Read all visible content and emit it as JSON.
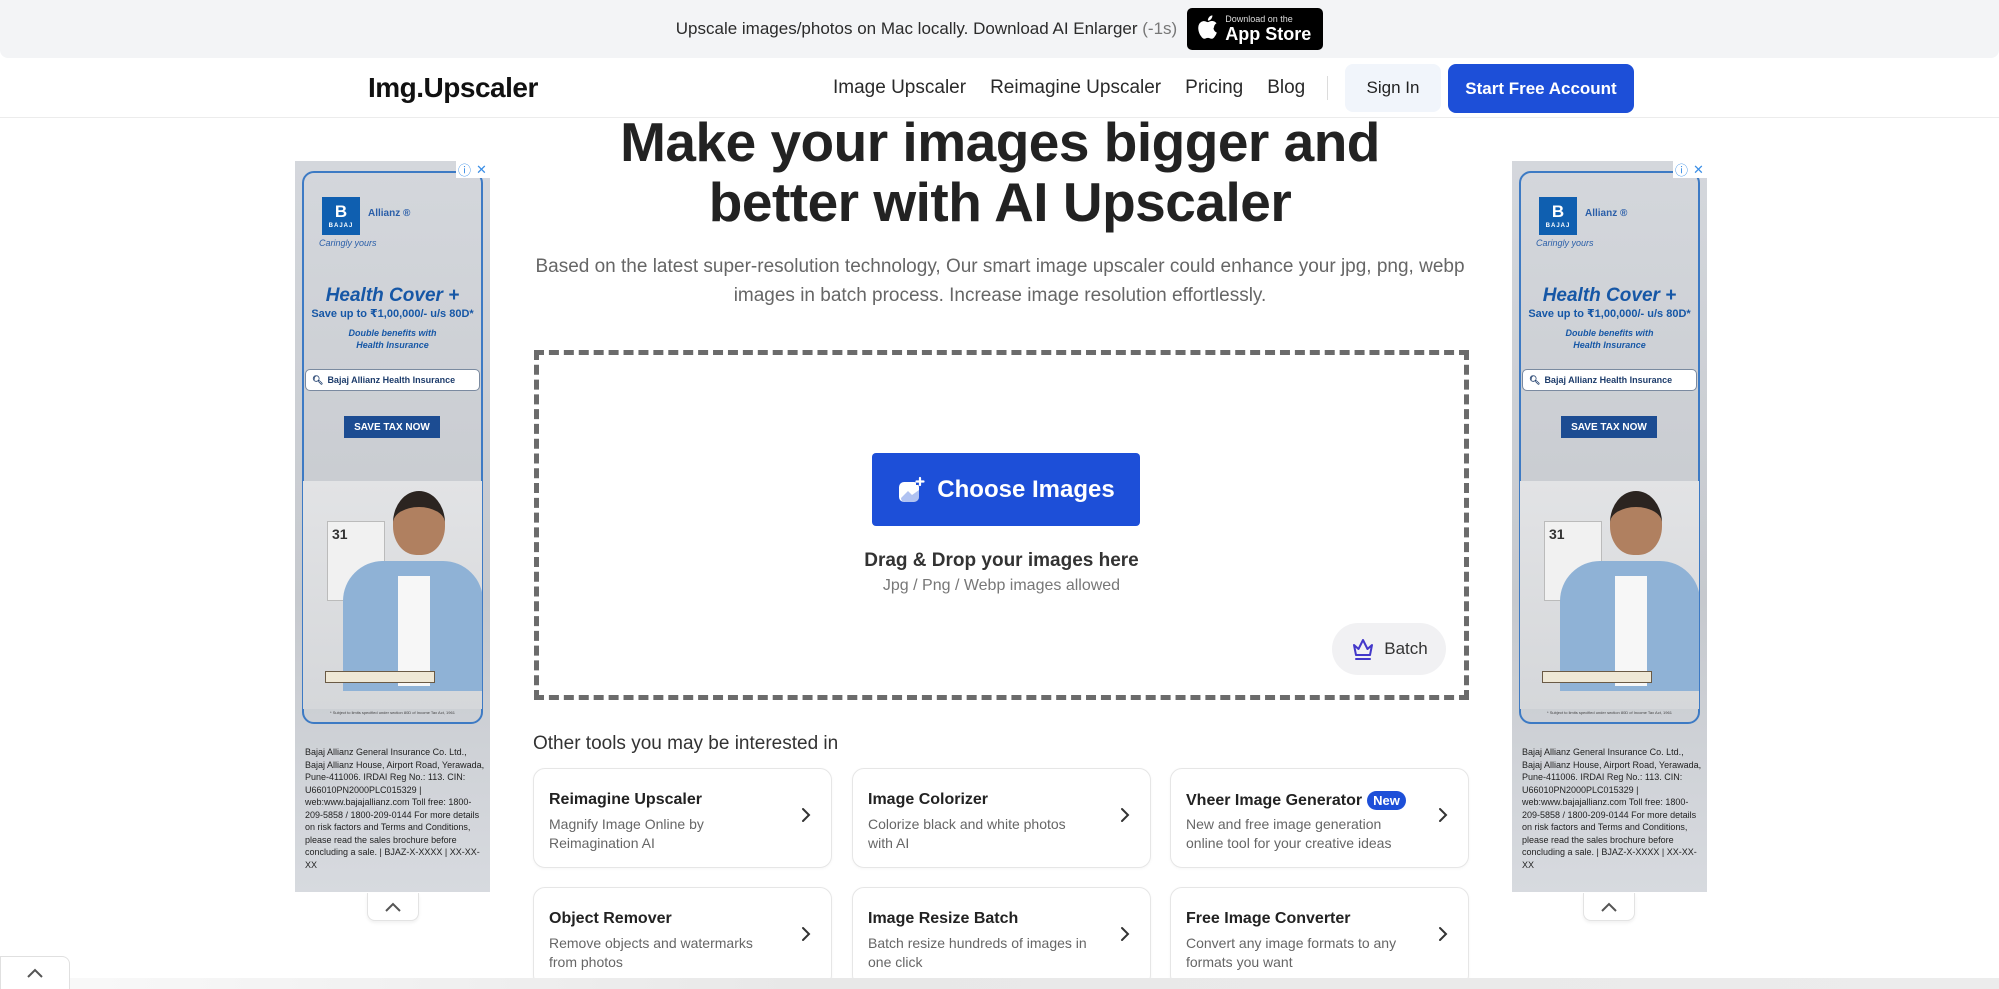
{
  "promo": {
    "text": "Upscale images/photos on Mac locally. Download AI Enlarger",
    "timer": "(-1s)",
    "appstore_small": "Download on the",
    "appstore_big": "App Store"
  },
  "nav": {
    "logo": "Img.Upscaler",
    "links": [
      "Image Upscaler",
      "Reimagine Upscaler",
      "Pricing",
      "Blog"
    ],
    "sign_in": "Sign In",
    "start_free": "Start Free Account"
  },
  "hero": {
    "title_line1": "Make your images bigger and",
    "title_line2": "better with AI Upscaler",
    "subtitle": "Based on the latest super-resolution technology, Our smart image upscaler could enhance your jpg, png, webp images in batch process. Increase image resolution effortlessly."
  },
  "dropzone": {
    "choose_label": "Choose Images",
    "drag_title": "Drag & Drop your images here",
    "drag_sub": "Jpg / Png / Webp images allowed",
    "batch_label": "Batch"
  },
  "tools": {
    "heading": "Other tools you may be interested in",
    "items": [
      {
        "title": "Reimagine Upscaler",
        "desc": "Magnify Image Online by Reimagination AI",
        "badge": ""
      },
      {
        "title": "Image Colorizer",
        "desc": "Colorize black and white photos with AI",
        "badge": ""
      },
      {
        "title": "Vheer Image Generator",
        "desc": "New and free image generation online tool for your creative ideas",
        "badge": "New"
      },
      {
        "title": "Object Remover",
        "desc": "Remove objects and watermarks from photos",
        "badge": ""
      },
      {
        "title": "Image Resize Batch",
        "desc": "Batch resize hundreds of images in one click",
        "badge": ""
      },
      {
        "title": "Free Image Converter",
        "desc": "Convert any image formats to any formats you want",
        "badge": ""
      }
    ]
  },
  "ad": {
    "brand_letter": "B",
    "brand_name": "BAJAJ",
    "partner": "Allianz ®",
    "tagline": "Caringly yours",
    "headline": "Health Cover +",
    "offer": "Save up to ₹1,00,000/- u/s 80D*",
    "benefit_line1": "Double benefits with",
    "benefit_line2": "Health Insurance",
    "search_text": "Bajaj Allianz Health Insurance",
    "cta": "SAVE TAX NOW",
    "calendar_day": "31",
    "footnote": "* Subject to limits specified under section 80D of Income Tax Act, 1961",
    "legal": "Bajaj Allianz General Insurance Co. Ltd., Bajaj Allianz House, Airport Road, Yerawada, Pune-411006. IRDAI Reg No.: 113. CIN: U66010PN2000PLC015329 | web:www.bajajallianz.com Toll free: 1800-209-5858 / 1800-209-0144 For more details on risk factors and Terms and Conditions, please read the sales brochure before concluding a sale. | BJAZ-X-XXXX | XX-XX-XX"
  },
  "colors": {
    "primary": "#1d4fd8",
    "ad_blue": "#1657a6"
  }
}
